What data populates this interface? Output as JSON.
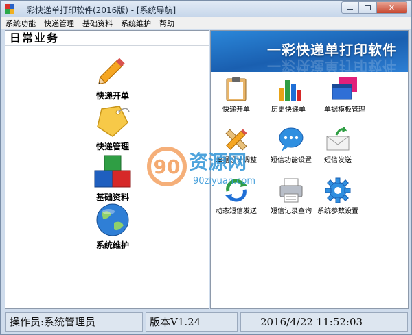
{
  "window": {
    "title": "一彩快递单打印软件(2016版) - [系统导航]",
    "controls": {
      "minimize": "▭",
      "maximize": "□",
      "close": "✕"
    }
  },
  "menu": [
    "系统功能",
    "快递管理",
    "基础资料",
    "系统维护",
    "帮助"
  ],
  "left_panel": {
    "header": "日常业务",
    "items": [
      {
        "label": "快递开单",
        "icon": "pencil-icon"
      },
      {
        "label": "快递管理",
        "icon": "tag-icon"
      },
      {
        "label": "基础资料",
        "icon": "blocks-icon"
      },
      {
        "label": "系统维护",
        "icon": "globe-icon"
      }
    ]
  },
  "right_panel": {
    "banner_text": "一彩快递单打印软件",
    "items": [
      {
        "label": "快递开单",
        "icon": "clipboard-icon"
      },
      {
        "label": "历史快递单",
        "icon": "bar-chart-icon"
      },
      {
        "label": "单据模板管理",
        "icon": "window-icon"
      },
      {
        "label": "单据设计调整",
        "icon": "ruler-pencil-icon"
      },
      {
        "label": "短信功能设置",
        "icon": "speech-bubble-icon"
      },
      {
        "label": "短信发送",
        "icon": "mail-send-icon"
      },
      {
        "label": "动态短信发送",
        "icon": "refresh-icon"
      },
      {
        "label": "短信记录查询",
        "icon": "printer-icon"
      },
      {
        "label": "系统参数设置",
        "icon": "gear-icon"
      }
    ]
  },
  "watermark": {
    "logo": "90",
    "text": "资源网",
    "url": "90ziyuan.com"
  },
  "status": {
    "operator": "操作员:系统管理员",
    "version": "版本V1.24",
    "datetime": "2016/4/22 11:52:03"
  },
  "colors": {
    "banner": "#1a5fb0",
    "watermark": "#3a9ad9",
    "close": "#c7462f"
  }
}
